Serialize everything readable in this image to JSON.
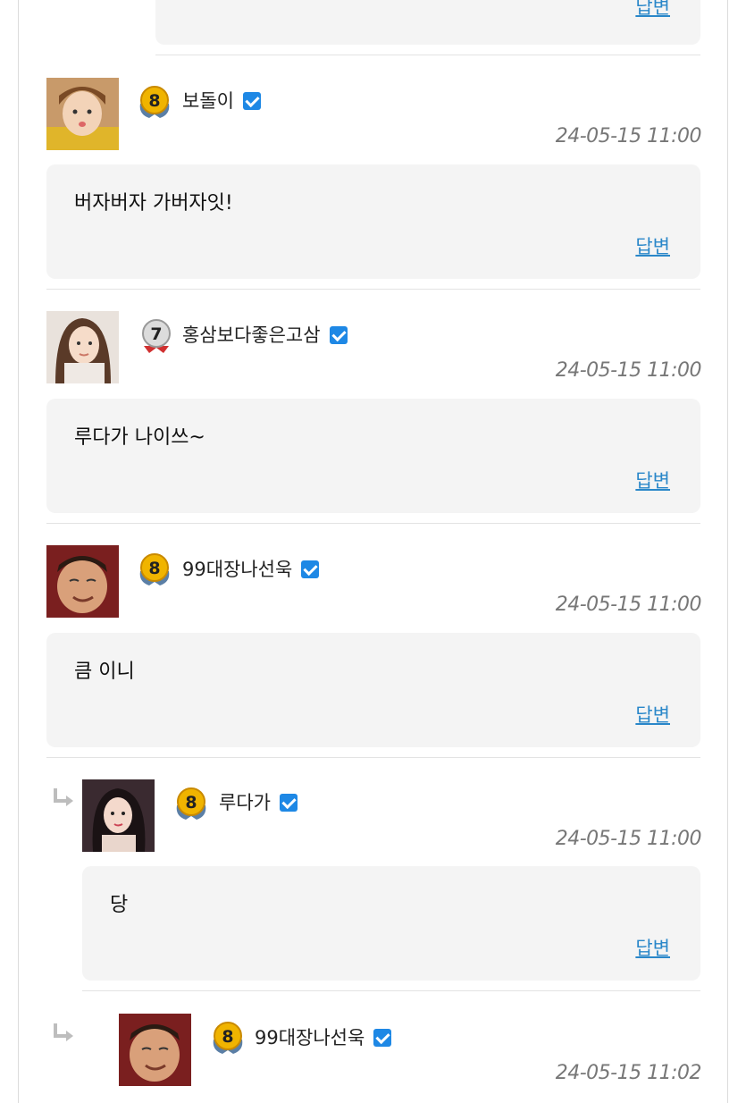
{
  "reply_label": "답변",
  "comments": [
    {
      "author": "보돌이",
      "level": "8",
      "time": "24-05-15 11:00",
      "text": "버자버자 가버자잇!"
    },
    {
      "author": "홍삼보다좋은고삼",
      "level": "7",
      "time": "24-05-15 11:00",
      "text": "루다가 나이쓰~"
    },
    {
      "author": "99대장나선욱",
      "level": "8",
      "time": "24-05-15 11:00",
      "text": "큼 이니"
    },
    {
      "author": "루다가",
      "level": "8",
      "time": "24-05-15 11:00",
      "text": "당"
    },
    {
      "author": "99대장나선욱",
      "level": "8",
      "time": "24-05-15 11:02",
      "text": ""
    }
  ],
  "colors": {
    "accent": "#2a87c9",
    "verified": "#1e88e5",
    "bubble": "#f4f4f4"
  }
}
